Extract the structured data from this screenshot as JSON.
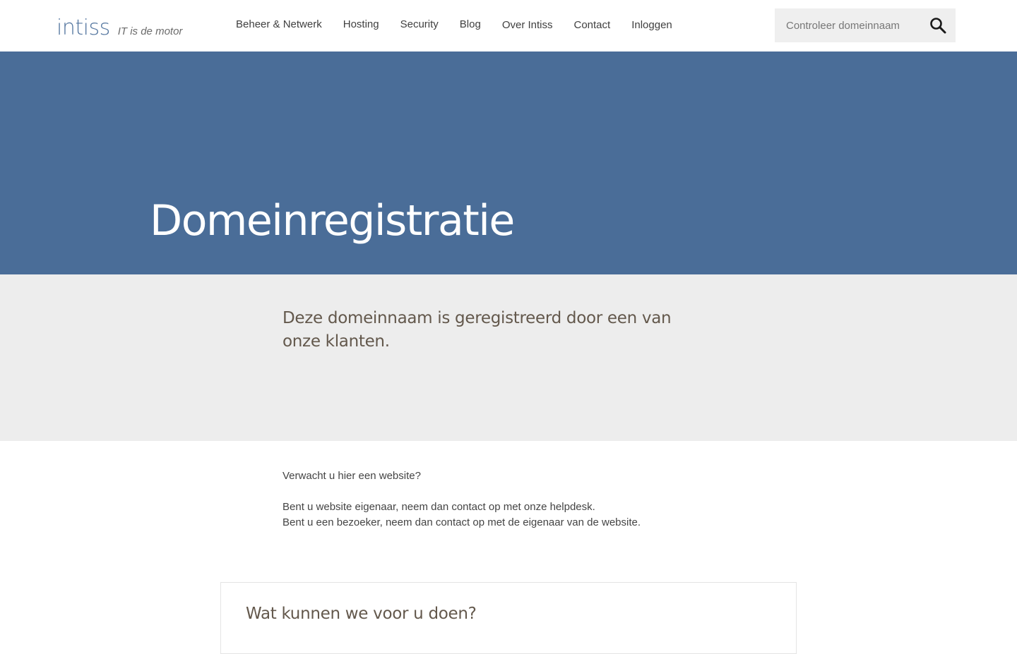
{
  "header": {
    "logo_text": "intiss",
    "tagline": "IT is de motor",
    "nav": [
      {
        "label": "Beheer & Netwerk"
      },
      {
        "label": "Hosting"
      },
      {
        "label": "Security"
      },
      {
        "label": "Blog"
      },
      {
        "label": "Over Intiss"
      },
      {
        "label": "Contact"
      },
      {
        "label": "Inloggen"
      }
    ],
    "search": {
      "placeholder": "Controleer domeinnaam",
      "value": "",
      "icon": "search-icon"
    }
  },
  "hero": {
    "title": "Domeinregistratie",
    "background": "#4a6d98"
  },
  "notice": {
    "text": "Deze domeinnaam is geregistreerd door een van onze klanten."
  },
  "body": {
    "question": "Verwacht u hier een website?",
    "line_owner": "Bent u website eigenaar, neem dan contact op met onze helpdesk.",
    "line_visitor": "Bent u een bezoeker, neem dan contact op met de eigenaar van de website."
  },
  "card": {
    "title": "Wat kunnen we voor u doen?"
  },
  "colors": {
    "accent": "#4a6d98",
    "notice_bg": "#ededed",
    "heading_text": "#63584c"
  }
}
